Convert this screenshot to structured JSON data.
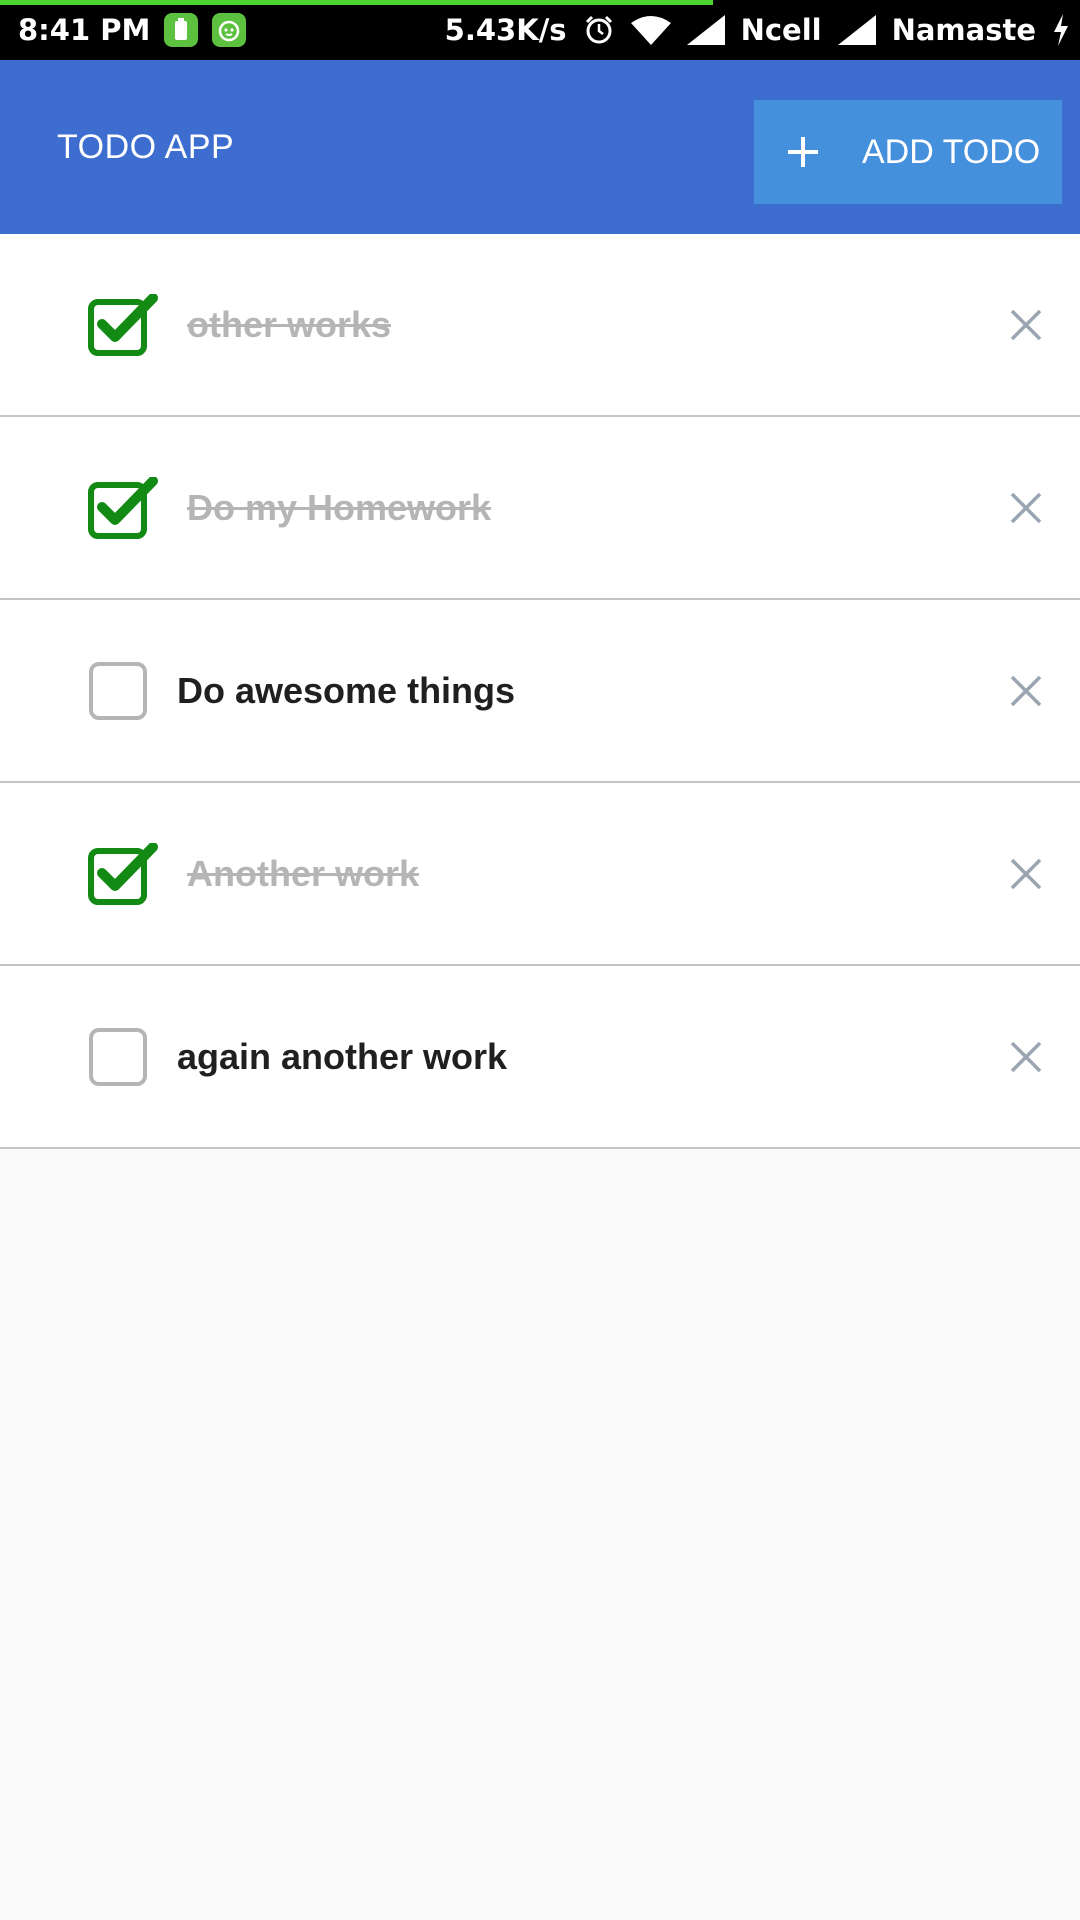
{
  "status_bar": {
    "time": "8:41 PM",
    "network_speed": "5.43K/s",
    "carrier_1": "Ncell",
    "carrier_2": "Namaste",
    "progress": 0.66,
    "icons": [
      "battery-app-icon",
      "android-app-icon",
      "alarm-icon",
      "wifi-icon",
      "signal-icon",
      "signal-icon",
      "charging-icon"
    ]
  },
  "app_bar": {
    "title": "TODO APP",
    "add_button_label": "ADD TODO",
    "add_icon": "plus-icon",
    "background": "#3d6ecf",
    "button_color": "#4590dc"
  },
  "todos": [
    {
      "text": "other works",
      "completed": true
    },
    {
      "text": "Do my Homework",
      "completed": true
    },
    {
      "text": "Do awesome things",
      "completed": false
    },
    {
      "text": "Another work",
      "completed": true
    },
    {
      "text": "again another work",
      "completed": false
    }
  ],
  "colors": {
    "check_green": "#138a13",
    "unchecked_border": "#b5b5b5",
    "delete_icon": "#9aa5b1"
  }
}
